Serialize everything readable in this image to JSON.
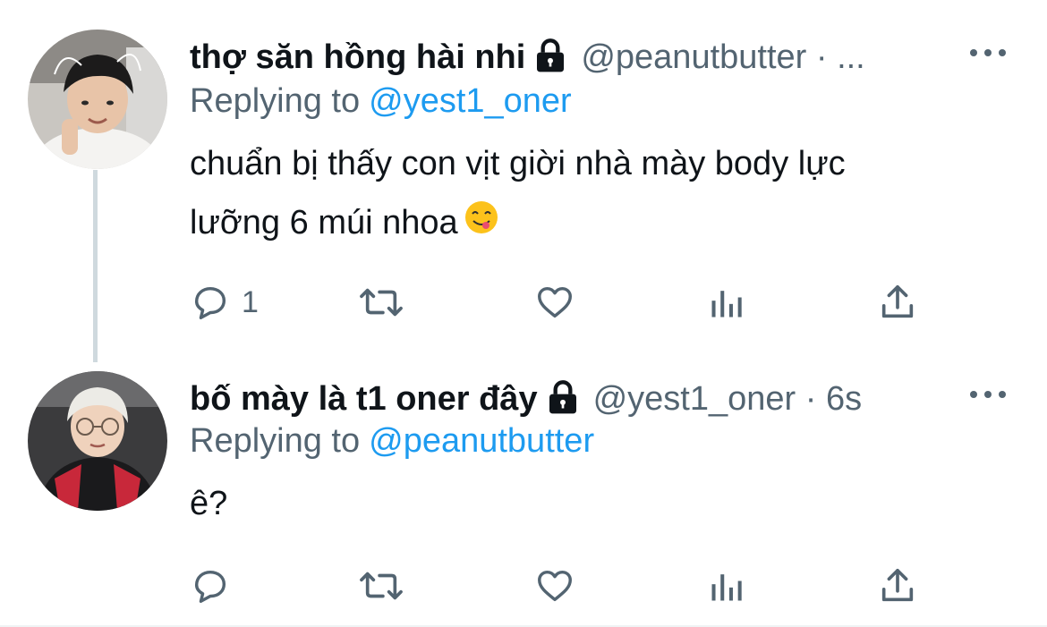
{
  "tweets": [
    {
      "display_name": "thợ săn hồng hài nhi",
      "handle": "@peanutbutter · ...",
      "replying_label": "Replying to",
      "replying_to": "@yest1_oner",
      "text": "chuẩn bị thấy con vịt giời nhà mày body lực\nlưỡng 6 múi nhoa",
      "emoji_icon": "yum-face-emoji-icon",
      "actions": {
        "reply_count": "1"
      }
    },
    {
      "display_name": "bố mày là t1 oner đây",
      "handle": "@yest1_oner · 6s",
      "replying_label": "Replying to",
      "replying_to": "@peanutbutter",
      "text": "ê?"
    }
  ],
  "icons": [
    "lock-icon",
    "more-icon",
    "reply-icon",
    "retweet-icon",
    "like-icon",
    "views-icon",
    "share-icon"
  ],
  "colors": {
    "text": "#0f1419",
    "secondary": "#536471",
    "link": "#1d9bf0",
    "thread_line": "#cfd9de"
  }
}
